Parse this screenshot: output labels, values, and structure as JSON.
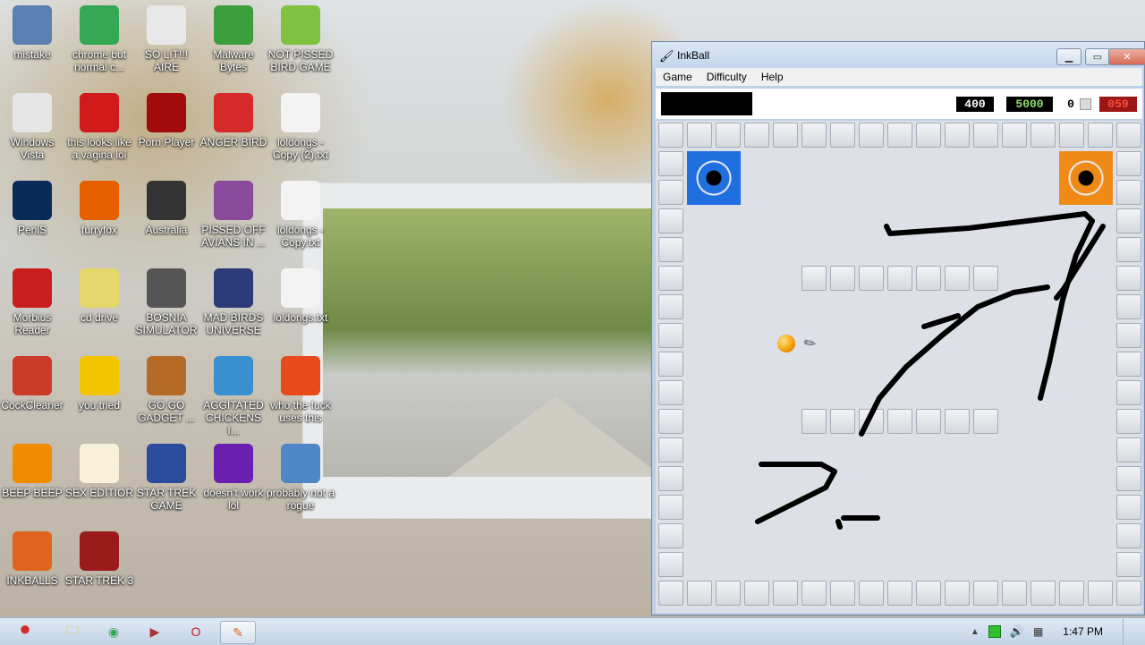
{
  "desktop": {
    "icons": [
      {
        "label": "mistake",
        "icon": "user-folder-icon",
        "color": "#5b7fb0"
      },
      {
        "label": "chrome but normal c...",
        "icon": "chrome-icon",
        "color": "#34a853"
      },
      {
        "label": "SO LIT!!! AIRE",
        "icon": "cards-icon",
        "color": "#e8e8e8"
      },
      {
        "label": "Malware Bytes",
        "icon": "shield-icon",
        "color": "#3c9e3c"
      },
      {
        "label": "NOT PISSED BIRD GAME",
        "icon": "pig-icon",
        "color": "#7fc241"
      },
      {
        "label": "Windows Vista",
        "icon": "recycle-bin-icon",
        "color": "#e6e6e6"
      },
      {
        "label": "this looks like a vagina lol",
        "icon": "opera-icon",
        "color": "#d11a1a"
      },
      {
        "label": "Porn Player",
        "icon": "flash-icon",
        "color": "#a10b0b"
      },
      {
        "label": "ANGER BIRD",
        "icon": "angry-bird-icon",
        "color": "#d62a2a"
      },
      {
        "label": "loldongs - Copy (2).txt",
        "icon": "text-file-icon",
        "color": "#f3f3f3"
      },
      {
        "label": "PeniS",
        "icon": "photoshop-icon",
        "color": "#0a2a57"
      },
      {
        "label": "furryfox",
        "icon": "firefox-icon",
        "color": "#e66000"
      },
      {
        "label": "Australia",
        "icon": "spider-icon",
        "color": "#333333"
      },
      {
        "label": "PISSED OFF AVIANS IN ...",
        "icon": "angry-bird-seasons-icon",
        "color": "#8a4a9c"
      },
      {
        "label": "loldongs - Copy.txt",
        "icon": "text-file-icon",
        "color": "#f3f3f3"
      },
      {
        "label": "Morbius Reader",
        "icon": "acrobat-icon",
        "color": "#c81e1e"
      },
      {
        "label": "cd drive",
        "icon": "cd-icon",
        "color": "#e7d66a"
      },
      {
        "label": "BOSNIA SIMULATOR",
        "icon": "mine-icon",
        "color": "#555555"
      },
      {
        "label": "MAD BIRDS UNIVERSE",
        "icon": "angry-bird-space-icon",
        "color": "#2b3b7a"
      },
      {
        "label": "loldongs.txt",
        "icon": "text-file-icon",
        "color": "#f3f3f3"
      },
      {
        "label": "CockCleaner",
        "icon": "ccleaner-icon",
        "color": "#cc3a2a"
      },
      {
        "label": "you tried",
        "icon": "star-icon",
        "color": "#f2c500"
      },
      {
        "label": "GO GO GADGET ...",
        "icon": "briefcase-icon",
        "color": "#b56a26"
      },
      {
        "label": "AGGITATED CHICKENS I...",
        "icon": "angry-bird-rio-icon",
        "color": "#3a8fd1"
      },
      {
        "label": "who the fuck uses this",
        "icon": "bolt-icon",
        "color": "#e84a1a"
      },
      {
        "label": "BEEP BEEP",
        "icon": "vlc-icon",
        "color": "#f08c00"
      },
      {
        "label": "SEX EDITIOR",
        "icon": "hxd-icon",
        "color": "#f6f1d8"
      },
      {
        "label": "STAR TREK GAME",
        "icon": "star-wars-icon",
        "color": "#2a4c9b"
      },
      {
        "label": "doesn't work lol",
        "icon": "yahoo-icon",
        "color": "#6b1fb0"
      },
      {
        "label": "probably not a rogue",
        "icon": "gear-computer-icon",
        "color": "#4f86c6"
      },
      {
        "label": "INKBALLS",
        "icon": "inkball-icon",
        "color": "#e0631e"
      },
      {
        "label": "STAR TREK 3",
        "icon": "star-wars-3-icon",
        "color": "#9b1b1b"
      }
    ]
  },
  "taskbar": {
    "start": "angry-bird-start-icon",
    "buttons": [
      {
        "name": "explorer-icon"
      },
      {
        "name": "chrome-icon"
      },
      {
        "name": "media-icon"
      },
      {
        "name": "opera-icon"
      },
      {
        "name": "inkball-icon",
        "active": true
      }
    ],
    "time": "1:47 PM"
  },
  "window": {
    "title": "InkBall",
    "menu": [
      "Game",
      "Difficulty",
      "Help"
    ],
    "scores": {
      "score": "400",
      "score_color": "#ffffff",
      "target": "5000",
      "target_color": "#8fe26a",
      "count": "0",
      "timer": "059",
      "timer_color": "#ff4b3a"
    },
    "colors": {
      "blue_hole": "#1f6fe0",
      "orange_hole": "#f08a17",
      "ball": "#f5a30a",
      "ink": "#000000"
    }
  }
}
